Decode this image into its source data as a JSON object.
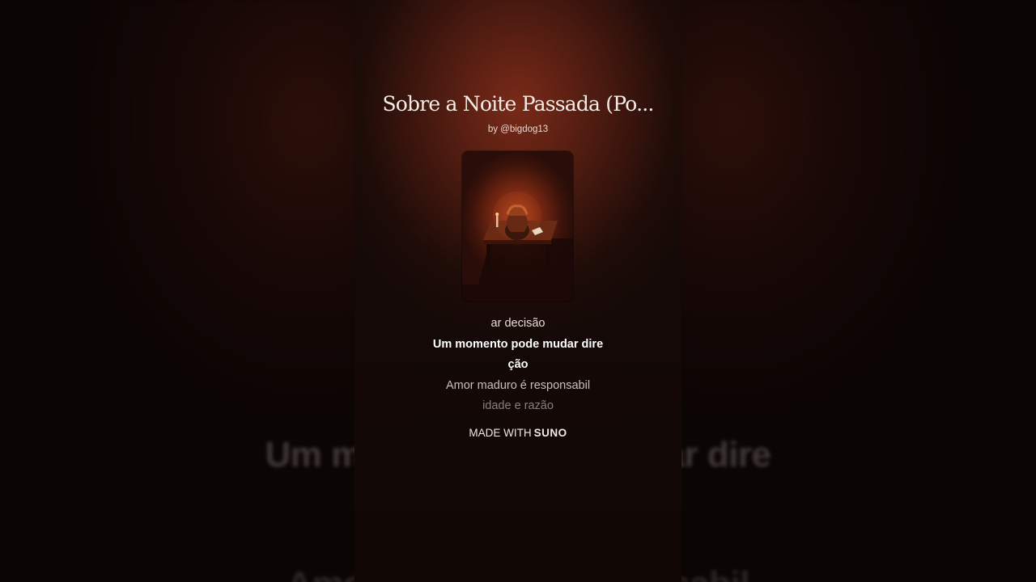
{
  "song": {
    "title": "Sobre a Noite Passada (Po...",
    "artist": "by @bigdog13"
  },
  "cover_art": {
    "icon": "album-cover-image",
    "description_colors": {
      "accent": "#b0431d",
      "dark": "#2a0d08"
    }
  },
  "lyrics": {
    "previous": "ar decisão",
    "current_line1": "Um momento pode mudar dire",
    "current_line2": "ção",
    "next_line1": "Amor maduro é responsabil",
    "next_line2": "idade e razão"
  },
  "footer": {
    "made_with": "MADE WITH",
    "brand": "SUNO"
  },
  "background": {
    "lyric_large_1": "Um momento pode mudar dire",
    "lyric_large_2": "Amor maduro é responsabil"
  }
}
